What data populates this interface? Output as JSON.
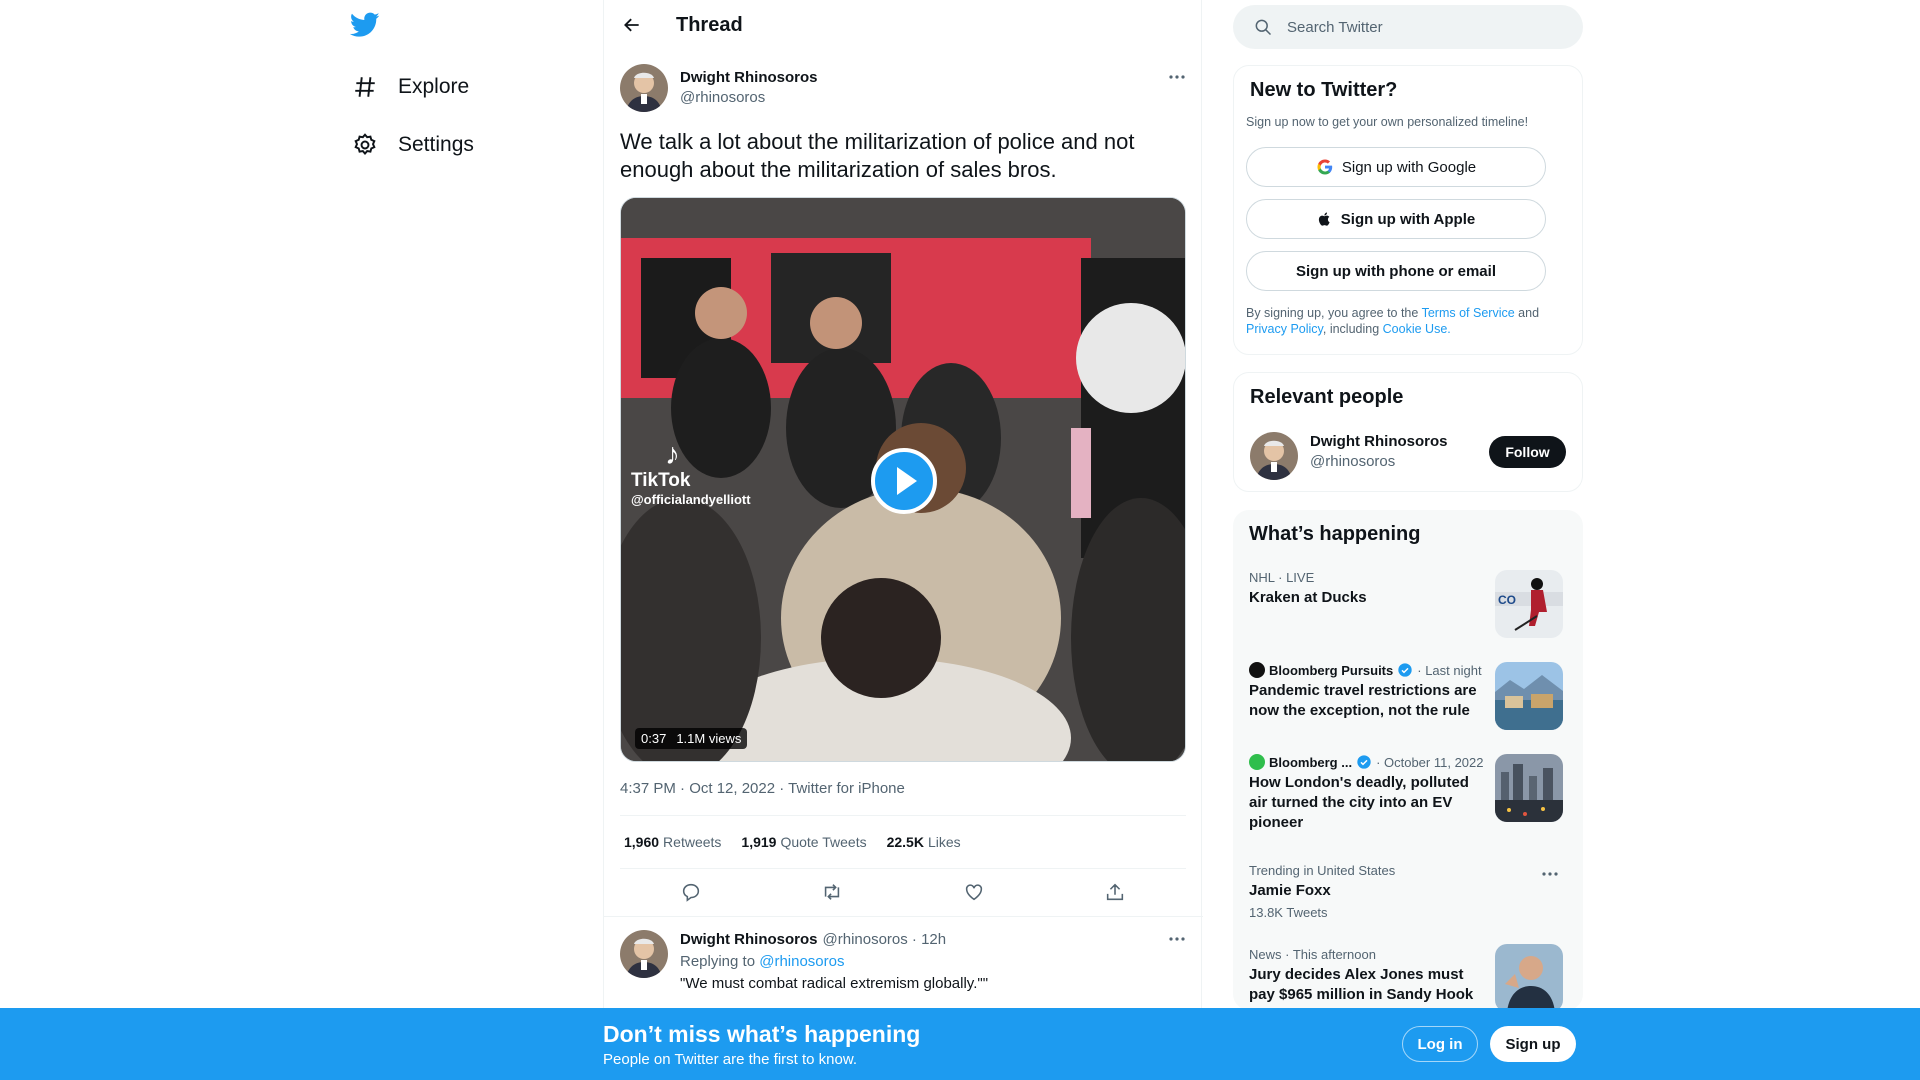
{
  "colors": {
    "accent": "#1d9bf0",
    "text": "#0f1419",
    "muted": "#536471"
  },
  "nav": {
    "logo_icon": "twitter-bird-icon",
    "items": [
      {
        "label": "Explore",
        "icon": "hashtag-icon"
      },
      {
        "label": "Settings",
        "icon": "gear-icon"
      }
    ]
  },
  "header": {
    "title": "Thread"
  },
  "tweet": {
    "author_name": "Dwight Rhinosoros",
    "handle": "@rhinosoros",
    "text": "We talk a lot about the militarization of police and not enough about the militarization of sales bros.",
    "video": {
      "duration": "0:37",
      "views": "1.1M views",
      "watermark": "TikTok",
      "watermark_user": "@officialandyelliott"
    },
    "timestamp": "4:37 PM · Oct 12, 2022 · Twitter for iPhone",
    "stats": [
      {
        "value": "1,960",
        "label": "Retweets"
      },
      {
        "value": "1,919",
        "label": "Quote Tweets"
      },
      {
        "value": "22.5K",
        "label": "Likes"
      }
    ]
  },
  "reply": {
    "author_name": "Dwight Rhinosoros",
    "handle_time": "@rhinosoros · 12h",
    "replying_prefix": "Replying to",
    "replying_to": "@rhinosoros",
    "text": "\"We must combat radical extremism globally.\"\""
  },
  "search": {
    "placeholder": "Search Twitter"
  },
  "new_to_twitter": {
    "title": "New to Twitter?",
    "subtitle": "Sign up now to get your own personalized timeline!",
    "google": "Sign up with Google",
    "apple": "Sign up with Apple",
    "phone": "Sign up with phone or email",
    "legal_1": "By signing up, you agree to the",
    "terms": "Terms of Service",
    "legal_2": "and",
    "privacy": "Privacy Policy",
    "legal_3": ", including",
    "cookie": "Cookie Use."
  },
  "relevant": {
    "title": "Relevant people",
    "name": "Dwight Rhinosoros",
    "handle": "@rhinosoros",
    "follow": "Follow"
  },
  "whats_happening": {
    "title": "What’s happening",
    "trends": [
      {
        "category": "NHL · LIVE",
        "title": "Kraken at Ducks"
      },
      {
        "source": "Bloomberg Pursuits",
        "time": "· Last night",
        "title": "Pandemic travel restrictions are now the exception, not the rule"
      },
      {
        "source": "Bloomberg ...",
        "time": "· October 11, 2022",
        "title": "How London's deadly, polluted air turned the city into an EV pioneer"
      },
      {
        "category": "Trending in United States",
        "title": "Jamie Foxx",
        "count": "13.8K Tweets"
      },
      {
        "category": "News · This afternoon",
        "title": "Jury decides Alex Jones must pay $965 million in Sandy Hook"
      }
    ]
  },
  "bottom_bar": {
    "title": "Don’t miss what’s happening",
    "subtitle": "People on Twitter are the first to know.",
    "login": "Log in",
    "signup": "Sign up"
  }
}
